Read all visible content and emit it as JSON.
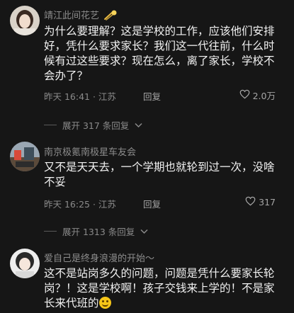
{
  "comments": [
    {
      "username": "靖江此间花艺",
      "user_badge": "comet-emoji-icon",
      "text": "为什么要理解？这是学校的工作，应该他们安排好，凭什么要求家长？我们这一代往前，什么时候有过这些要求？现在怎么，离了家长，学校不会办了？",
      "time_location": "昨天 16:41 · 江苏",
      "reply_label": "回复",
      "likes": "2.0万",
      "expand_label": "展开 317 条回复"
    },
    {
      "username": "南京极氪南极星车友会",
      "text": "又不是天天去，一个学期也就轮到过一次，没啥不妥",
      "time_location": "昨天 16:25 · 江苏",
      "reply_label": "回复",
      "likes": "317",
      "expand_label": "展开 1313 条回复"
    },
    {
      "username": "爱自己是终身浪漫的开始～",
      "text": "这不是站岗多久的问题，问题是凭什么要家长轮岗？！这是学校啊！孩子交钱来上学的！不是家长来代班的",
      "trailing_emoji": "smile-emoji-icon"
    }
  ],
  "colors": {
    "background": "#161616",
    "username": "#8d8d8d",
    "body_text": "#f2f2f2",
    "meta_text": "#8a8a8a"
  }
}
